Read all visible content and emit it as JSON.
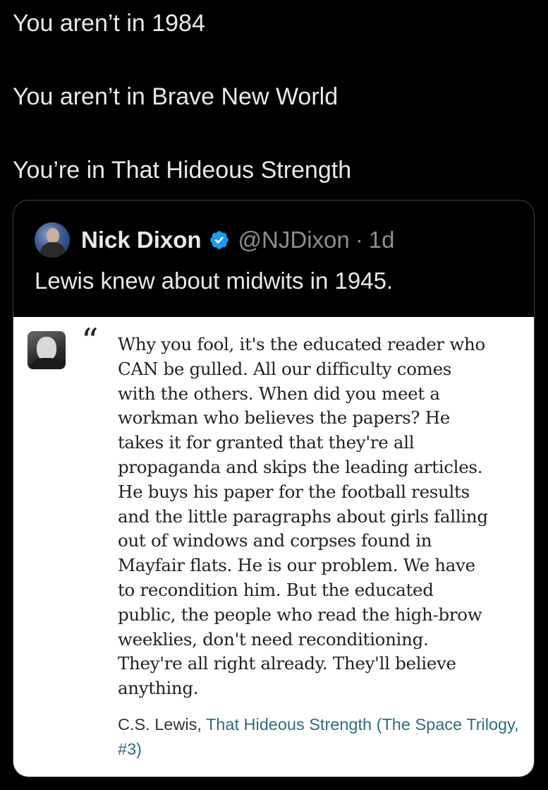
{
  "tweet": {
    "lines": [
      "You aren’t in 1984",
      "You aren’t in Brave New World",
      "You’re in That Hideous Strength"
    ]
  },
  "quoted_tweet": {
    "author_name": "Nick Dixon",
    "handle": "@NJDixon",
    "separator": "·",
    "time": "1d",
    "text": "Lewis knew about midwits in 1945.",
    "verified_color": "#1d9bf0",
    "embedded_image": {
      "quote_mark": "“",
      "excerpt_lines": [
        "Why you fool, it's the educated reader who",
        "CAN be gulled. All our difficulty comes",
        "with the others. When did you meet a",
        "workman who believes the papers? He",
        "takes it for granted that they're all",
        "propaganda and skips the leading articles.",
        "He buys his paper for the football results",
        "and the little paragraphs about girls falling",
        "out of windows and corpses found in",
        "Mayfair flats. He is our problem. We have",
        "to recondition him. But the educated",
        "public, the people who read the high-brow",
        "weeklies, don't need reconditioning.",
        "They're all right already. They'll believe",
        "anything."
      ],
      "attribution_author": "C.S. Lewis, ",
      "attribution_book": "That Hideous Strength (The Space Trilogy, #3)",
      "link_color": "#2b6e7e"
    }
  }
}
